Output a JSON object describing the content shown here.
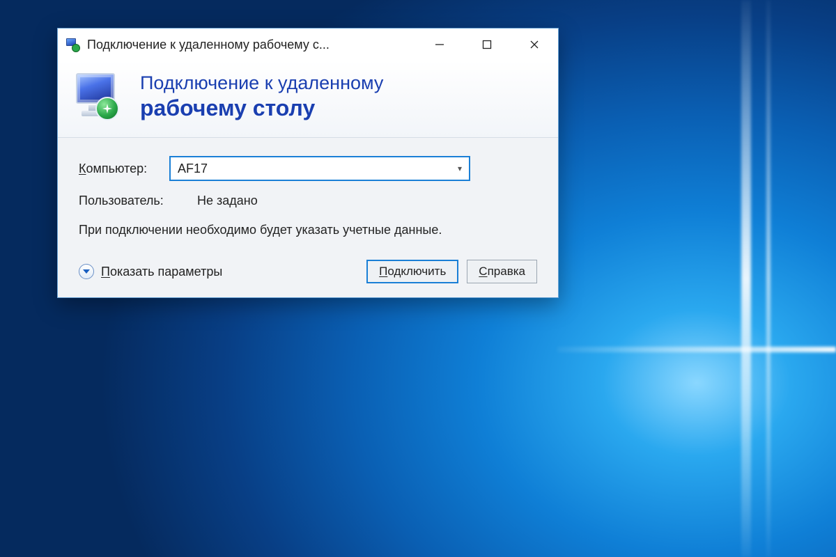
{
  "window": {
    "title": "Подключение к удаленному рабочему с..."
  },
  "header": {
    "line1": "Подключение к удаленному",
    "line2": "рабочему столу"
  },
  "form": {
    "computer_label_pre": "К",
    "computer_label_rest": "омпьютер:",
    "computer_value": "AF17",
    "user_label": "Пользователь:",
    "user_value": "Не задано",
    "info_text": "При подключении необходимо будет указать учетные данные."
  },
  "footer": {
    "show_options_pre": "П",
    "show_options_rest": "оказать параметры",
    "connect_pre": "П",
    "connect_rest": "одключить",
    "help_pre": "С",
    "help_rest": "правка"
  }
}
